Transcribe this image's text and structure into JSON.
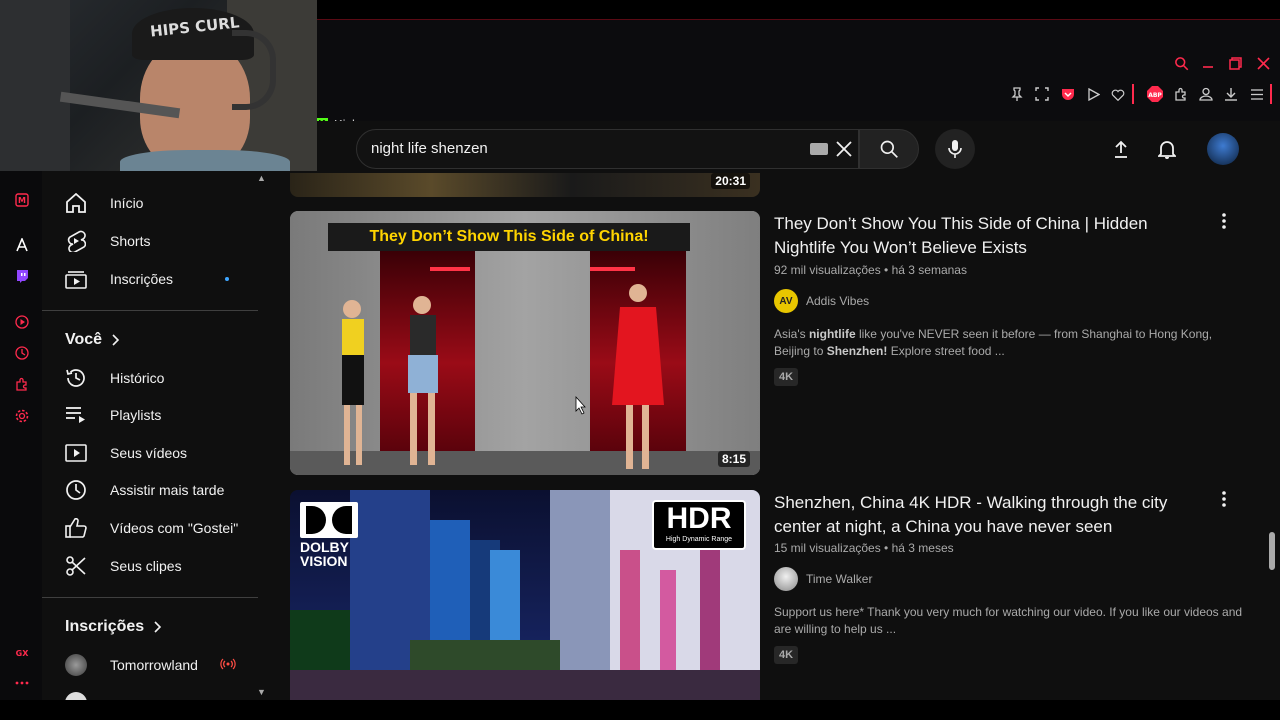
{
  "browser": {
    "bookmark_label": "Kick",
    "bookmark_icon_letter": "K"
  },
  "webcam": {
    "cap_text": "HIPS CURL"
  },
  "header": {
    "search_value": "night life shenzen"
  },
  "sidebar": {
    "main_items": [
      {
        "label": "Início",
        "icon": "home-icon"
      },
      {
        "label": "Shorts",
        "icon": "shorts-icon"
      },
      {
        "label": "Inscrições",
        "icon": "subscriptions-icon"
      }
    ],
    "you_title": "Você",
    "you_items": [
      {
        "label": "Histórico",
        "icon": "history-icon"
      },
      {
        "label": "Playlists",
        "icon": "playlists-icon"
      },
      {
        "label": "Seus vídeos",
        "icon": "your-videos-icon"
      },
      {
        "label": "Assistir mais tarde",
        "icon": "watch-later-icon"
      },
      {
        "label": "Vídeos com \"Gostei\"",
        "icon": "liked-icon"
      },
      {
        "label": "Seus clipes",
        "icon": "clips-icon"
      }
    ],
    "subs_title": "Inscrições",
    "subs_items": [
      {
        "label": "Tomorrowland",
        "icon": "live-icon"
      }
    ]
  },
  "results": {
    "prev_duration": "20:31",
    "videos": [
      {
        "title": "They Don’t Show You This Side of China | Hidden Nightlife You Won’t Believe Exists",
        "meta": "92 mil visualizações • há 3 semanas",
        "channel": "Addis Vibes",
        "channel_avatar_text": "AV",
        "description_pre": "Asia's ",
        "description_bold1": "nightlife",
        "description_mid": " like you've NEVER seen it before — from Shanghai to Hong Kong, Beijing to ",
        "description_bold2": "Shenzhen!",
        "description_post": " Explore street food ...",
        "badge": "4K",
        "duration": "8:15",
        "thumb_caption": "They Don’t Show This Side of China!"
      },
      {
        "title": "Shenzhen, China 4K HDR - Walking through the city center at night, a China you have never seen",
        "meta": "15 mil visualizações • há 3 meses",
        "channel": "Time Walker",
        "description": "Support us here* Thank you very much for watching our video. If you like our videos and are willing to help us ...",
        "badge": "4K",
        "thumb_logo_dolby_line1": "DOLBY",
        "thumb_logo_dolby_line2": "VISION",
        "thumb_logo_hdr": "HDR",
        "thumb_logo_hdr_sub": "High Dynamic Range"
      }
    ]
  },
  "colors": {
    "accent_gx": "#ff2a4d",
    "yt_bg": "#0f0f0f",
    "text": "#f1f1f1",
    "muted": "#aaaaaa",
    "thumb_caption_bg": "#1a1a1a",
    "thumb_caption_text": "#ffd400"
  }
}
